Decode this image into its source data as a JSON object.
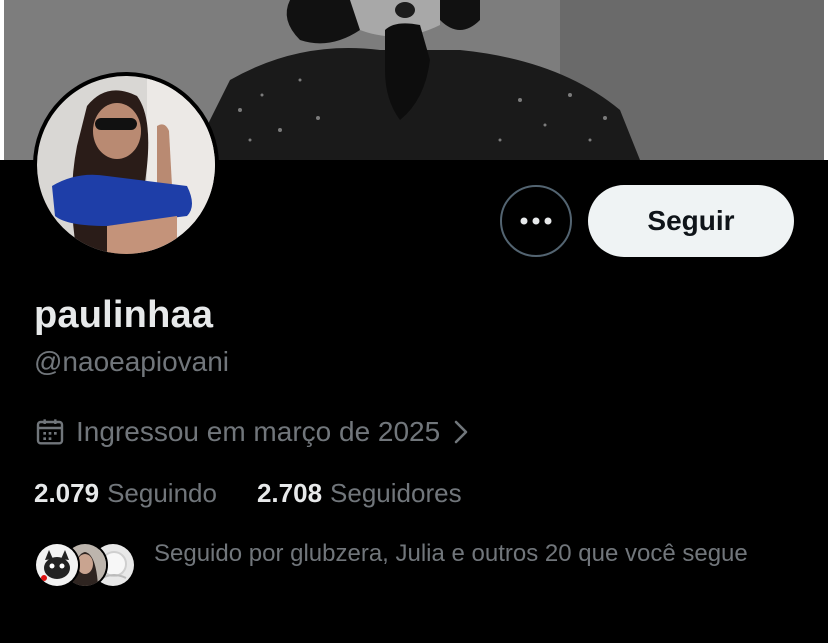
{
  "profile": {
    "display_name": "paulinhaa",
    "handle": "@naoeapiovani",
    "joined": "Ingressou em março de 2025",
    "follow_label": "Seguir"
  },
  "stats": {
    "following_count": "2.079",
    "following_label": "Seguindo",
    "followers_count": "2.708",
    "followers_label": "Seguidores"
  },
  "followers_you_know": {
    "text": "Seguido por glubzera, Julia e outros 20 que você segue"
  },
  "icons": {
    "more": "more-horizontal-icon",
    "calendar": "calendar-icon",
    "chevron": "chevron-right-icon"
  },
  "colors": {
    "background": "#000000",
    "primary_text": "#e7e9ea",
    "secondary_text": "#71767b",
    "follow_button_bg": "#eff3f4",
    "border": "#536471"
  }
}
